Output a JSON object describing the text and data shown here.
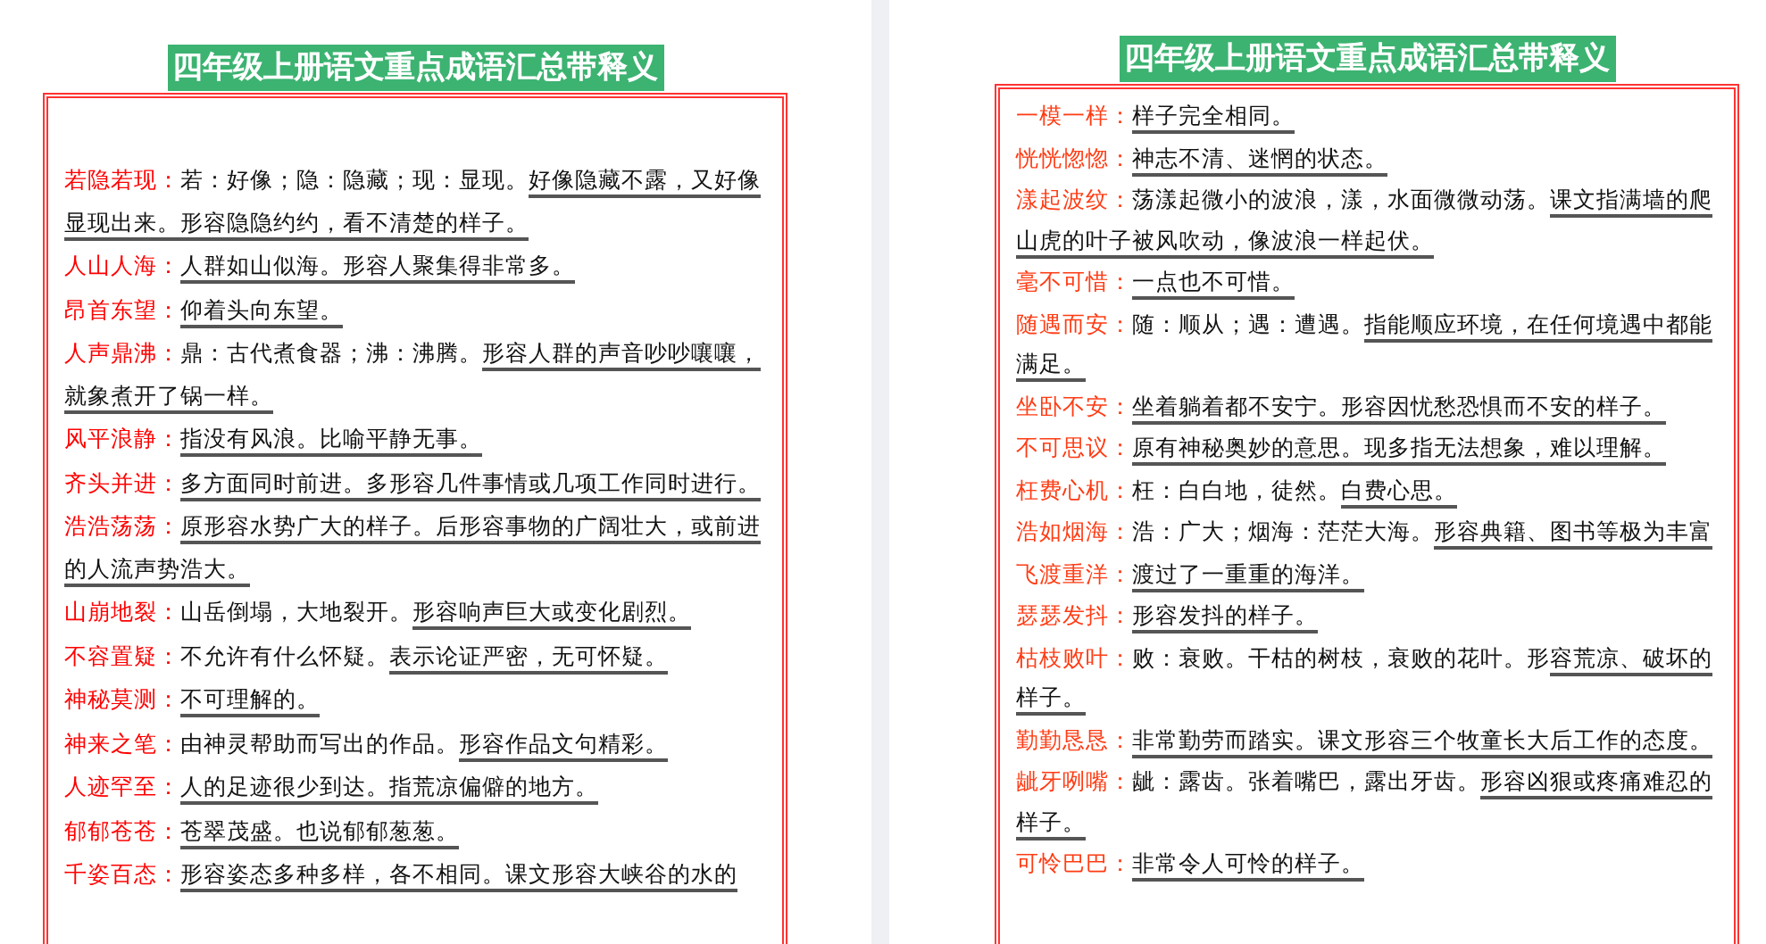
{
  "pages": [
    {
      "title": "四年级上册语文重点成语汇总带释义",
      "entries": [
        {
          "term": "若隐若现：",
          "plain": "若：好像；隐：隐藏；现：显现。",
          "underlined": "好像隐藏不露，又好像显现出来。形容隐隐约约，看不清楚的样子。"
        },
        {
          "term": "人山人海：",
          "underlined": "人群如山似海。形容人聚集得非常多。"
        },
        {
          "term": "昂首东望：",
          "underlined": "仰着头向东望。"
        },
        {
          "term": "人声鼎沸：",
          "plain": "鼎：古代煮食器；沸：沸腾。",
          "underlined": "形容人群的声音吵吵嚷嚷，就象煮开了锅一样。"
        },
        {
          "term": "风平浪静：",
          "underlined": "指没有风浪。比喻平静无事。"
        },
        {
          "term": "齐头并进：",
          "underlined": "多方面同时前进。多形容几件事情或几项工作同时进行。"
        },
        {
          "term": "浩浩荡荡：",
          "underlined": "原形容水势广大的样子。后形容事物的广阔壮大，或前进的人流声势浩大。"
        },
        {
          "term": "山崩地裂：",
          "plain": "山岳倒塌，大地裂开。",
          "underlined": "形容响声巨大或变化剧烈。"
        },
        {
          "term": "不容置疑：",
          "plain": "不允许有什么怀疑。",
          "underlined": "表示论证严密，无可怀疑。"
        },
        {
          "term": "神秘莫测：",
          "underlined": "不可理解的。"
        },
        {
          "term": "神来之笔：",
          "plain": "由神灵帮助而写出的作品。",
          "underlined": "形容作品文句精彩。"
        },
        {
          "term": "人迹罕至：",
          "underlined": "人的足迹很少到达。指荒凉偏僻的地方。"
        },
        {
          "term": "郁郁苍苍：",
          "underlined": "苍翠茂盛。也说郁郁葱葱。"
        },
        {
          "term": "千姿百态：",
          "underlined": "形容姿态多种多样，各不相同。课文形容大峡谷的水的"
        }
      ]
    },
    {
      "title": "四年级上册语文重点成语汇总带释义",
      "entries": [
        {
          "term": "一模一样：",
          "underlined": "样子完全相同。"
        },
        {
          "term": "恍恍惚惚：",
          "underlined": "神志不清、迷惘的状态。"
        },
        {
          "term": "漾起波纹：",
          "plain": "荡漾起微小的波浪，漾，水面微微动荡。",
          "underlined": "课文指满墙的爬山虎的叶子被风吹动，像波浪一样起伏。"
        },
        {
          "term": "毫不可惜：",
          "underlined": "一点也不可惜。"
        },
        {
          "term": "随遇而安：",
          "plain": "随：顺从；遇：遭遇。",
          "underlined": "指能顺应环境，在任何境遇中都能满足。"
        },
        {
          "term": "坐卧不安：",
          "underlined": "坐着躺着都不安宁。形容因忧愁恐惧而不安的样子。"
        },
        {
          "term": "不可思议：",
          "underlined": "原有神秘奥妙的意思。现多指无法想象，难以理解。"
        },
        {
          "term": "枉费心机：",
          "plain": "枉：白白地，徒然。",
          "underlined": "白费心思。"
        },
        {
          "term": "浩如烟海：",
          "plain": "浩：广大；烟海：茫茫大海。",
          "underlined": "形容典籍、图书等极为丰富"
        },
        {
          "term": "飞渡重洋：",
          "underlined": "渡过了一重重的海洋。"
        },
        {
          "term": "瑟瑟发抖：",
          "underlined": "形容发抖的样子。"
        },
        {
          "term": "枯枝败叶：",
          "plain": "败：衰败。干枯的树枝，衰败的花叶。形",
          "underlined": "容荒凉、破坏的样子。"
        },
        {
          "term": "勤勤恳恳：",
          "underlined": "非常勤劳而踏实。课文形容三个牧童长大后工作的态度。"
        },
        {
          "term": "龇牙咧嘴：",
          "plain": "龇：露齿。张着嘴巴，露出牙齿。",
          "underlined": "形容凶狠或疼痛难忍的样子。"
        },
        {
          "term": "可怜巴巴：",
          "underlined": "非常令人可怜的样子。"
        }
      ]
    }
  ]
}
